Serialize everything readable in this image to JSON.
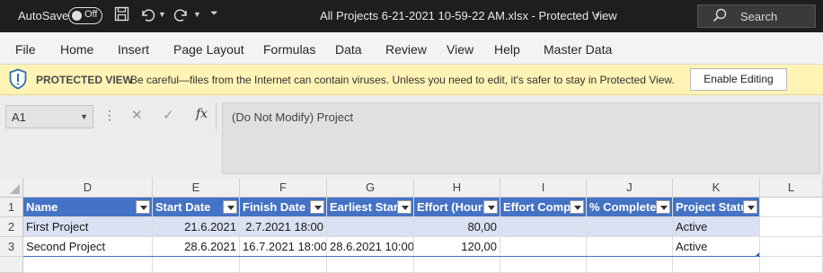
{
  "titlebar": {
    "autosave_label": "AutoSave",
    "autosave_state": "Off",
    "save_icon": "save-icon",
    "undo_icon": "undo-icon",
    "redo_icon": "redo-icon",
    "title": "All Projects 6-21-2021 10-59-22 AM.xlsx  -  Protected View",
    "search_placeholder": "Search"
  },
  "ribbon": {
    "tabs": [
      "File",
      "Home",
      "Insert",
      "Page Layout",
      "Formulas",
      "Data",
      "Review",
      "View",
      "Help",
      "Master Data"
    ]
  },
  "protected_view": {
    "title": "PROTECTED VIEW",
    "message": "Be careful—files from the Internet can contain viruses. Unless you need to edit, it's safer to stay in Protected View.",
    "button": "Enable Editing",
    "bar_color": "#fff3b5"
  },
  "formula_bar": {
    "name_box": "A1",
    "cancel_symbol": "✕",
    "enter_symbol": "✓",
    "fx_symbol": "fx",
    "content": "(Do Not Modify) Project"
  },
  "sheet": {
    "column_letters": [
      "D",
      "E",
      "F",
      "G",
      "H",
      "I",
      "J",
      "K",
      "L"
    ],
    "row_numbers": [
      "1",
      "2",
      "3"
    ],
    "headers": [
      "Name",
      "Start Date",
      "Finish Date",
      "Earliest Start",
      "Effort (Hours",
      "Effort Compl",
      "% Complete",
      "Project Statu"
    ],
    "rows": [
      [
        "First Project",
        "21.6.2021",
        "2.7.2021 18:00",
        "",
        "80,00",
        "",
        "",
        "Active"
      ],
      [
        "Second Project",
        "28.6.2021",
        "16.7.2021 18:00",
        "28.6.2021 10:00",
        "120,00",
        "",
        "",
        "Active"
      ]
    ],
    "table_header_color": "#4472c4",
    "band_color": "#d9e1f2"
  }
}
